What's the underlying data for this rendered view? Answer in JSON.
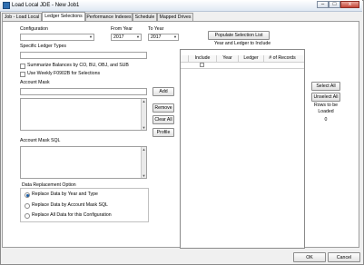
{
  "window": {
    "title": "Load Local JDE - New Job1",
    "minimize": "–",
    "maximize": "□",
    "close": "x"
  },
  "tabs": [
    {
      "label": "Job - Load Local"
    },
    {
      "label": "Ledger Selections"
    },
    {
      "label": "Performance Indexes"
    },
    {
      "label": "Schedule"
    },
    {
      "label": "Mapped Drives"
    }
  ],
  "form": {
    "configuration_label": "Configuration",
    "configuration_value": "",
    "from_year_label": "From Year",
    "from_year_value": "2017",
    "to_year_label": "To Year",
    "to_year_value": "2017",
    "specific_ledger_label": "Specific Ledger Types",
    "specific_ledger_value": "",
    "summarize_label": "Summarize Balances by CO, BU, OBJ, and SUB",
    "weekly_label": "Use Weekly F0902B for Selections",
    "account_mask_label": "Account Mask",
    "account_mask_value": "",
    "add_button": "Add",
    "remove_button": "Remove",
    "clear_all_button": "Clear All",
    "profile_button": "Profile",
    "account_mask_sql_label": "Account Mask SQL"
  },
  "replacement": {
    "group_label": "Data Replacement Option",
    "options": [
      "Replace Data by Year and Type",
      "Replace Data by Account Mask SQL",
      "Replace All Data for this Configuration"
    ],
    "selected_index": 0
  },
  "selection": {
    "populate_button": "Populate Selection List",
    "list_label": "Year and Ledger to Include",
    "columns": [
      "Include",
      "Year",
      "Ledger",
      "# of Records"
    ],
    "select_all_button": "Select All",
    "unselect_all_button": "Unselect All",
    "rows_label": "Rows to be Loaded",
    "rows_count": "0"
  },
  "footer": {
    "ok_button": "OK",
    "cancel_button": "Cancel"
  },
  "colors": {
    "accent": "#1d5fa7",
    "window_bg": "#f0f0f0",
    "panel_bg": "#ffffff"
  },
  "icons": {
    "app": "app-icon",
    "dropdown": "chevron-down-icon"
  }
}
